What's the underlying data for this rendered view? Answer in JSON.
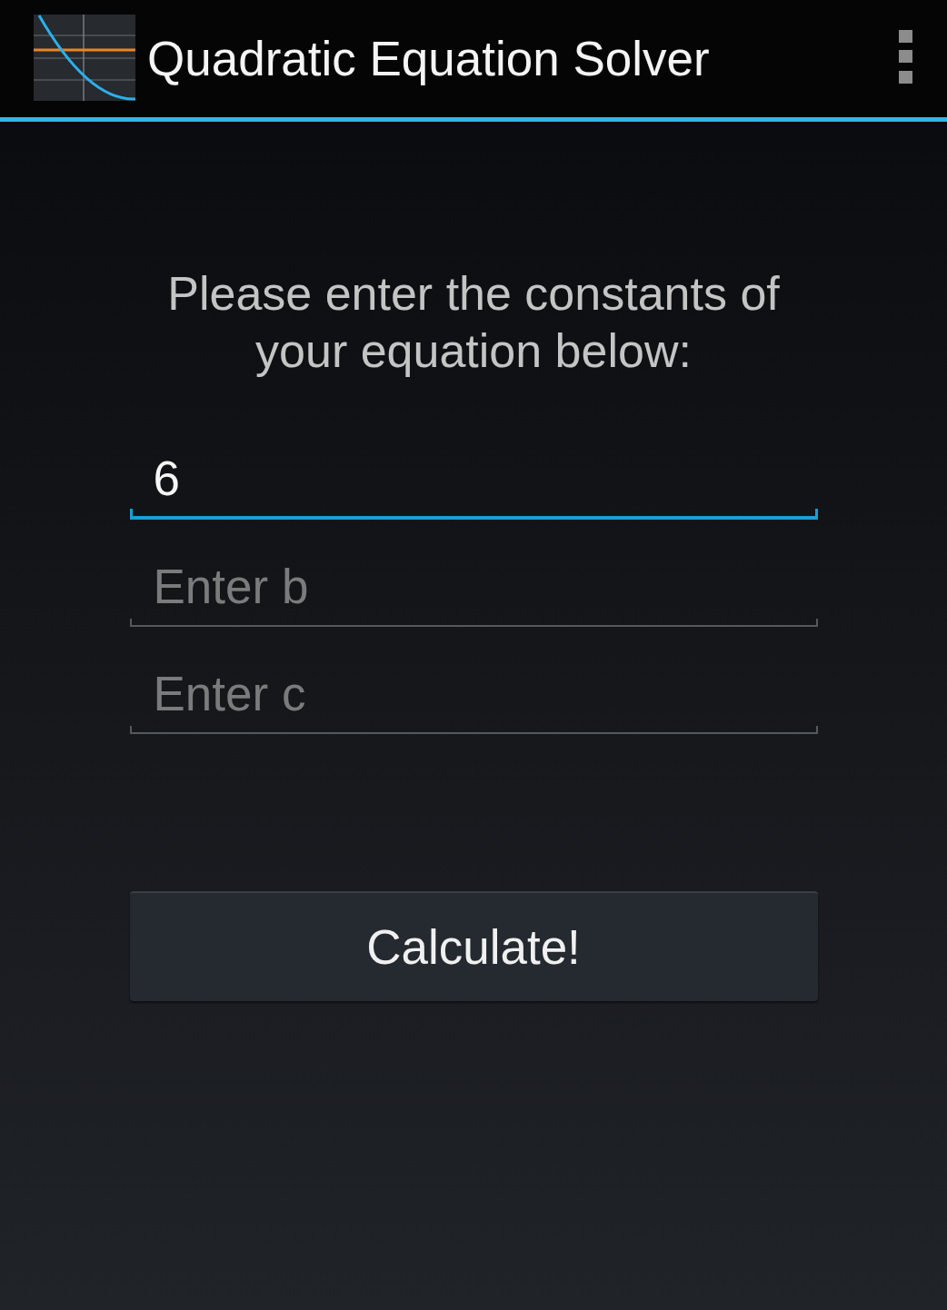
{
  "action_bar": {
    "title": "Quadratic Equation Solver"
  },
  "prompt": "Please enter the constants of your equation below:",
  "fields": [
    {
      "value": "6",
      "focused": true
    },
    {
      "placeholder": "Enter b",
      "focused": false
    },
    {
      "placeholder": "Enter c",
      "focused": false
    }
  ],
  "button": {
    "label": "Calculate!"
  }
}
